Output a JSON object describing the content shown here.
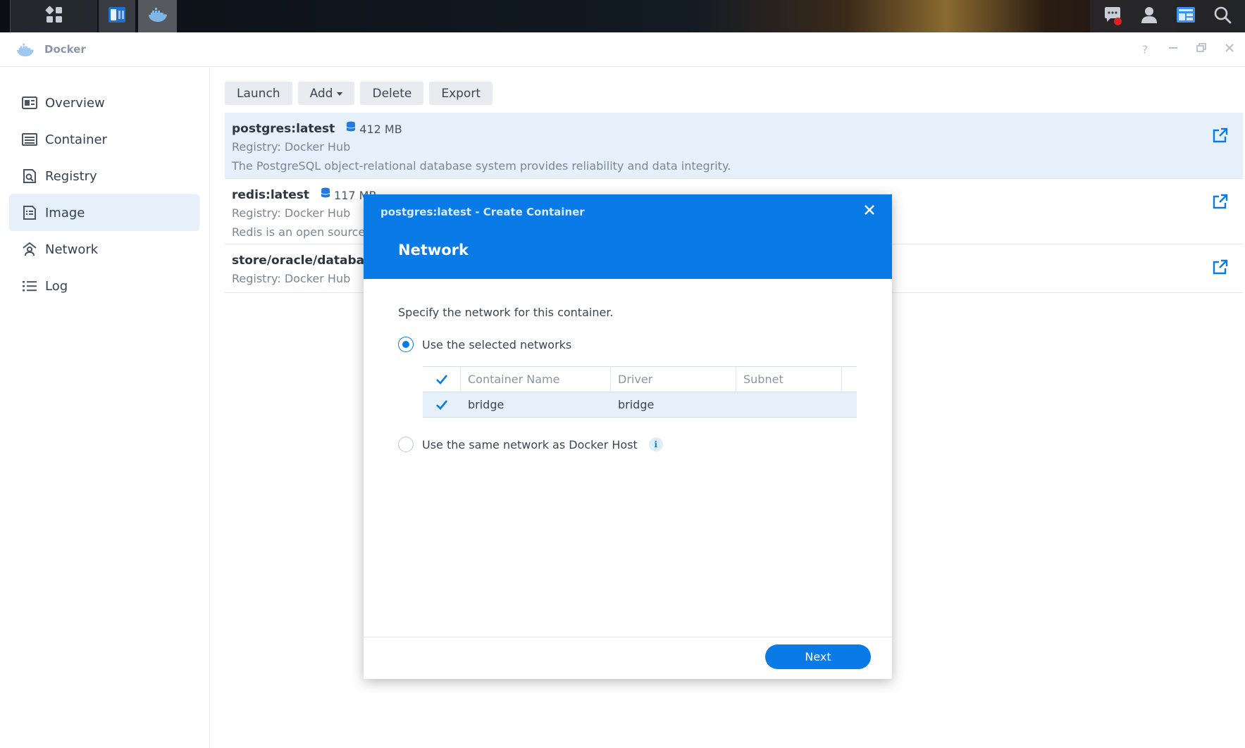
{
  "window": {
    "title": "Docker"
  },
  "sidebar": {
    "items": [
      {
        "label": "Overview",
        "icon": "overview-icon"
      },
      {
        "label": "Container",
        "icon": "container-icon"
      },
      {
        "label": "Registry",
        "icon": "registry-icon"
      },
      {
        "label": "Image",
        "icon": "image-icon",
        "active": true
      },
      {
        "label": "Network",
        "icon": "network-icon"
      },
      {
        "label": "Log",
        "icon": "log-icon"
      }
    ]
  },
  "toolbar": {
    "launch": "Launch",
    "add": "Add",
    "delete": "Delete",
    "export": "Export"
  },
  "images": [
    {
      "name": "postgres:latest",
      "size": "412 MB",
      "registry": "Registry: Docker Hub",
      "description": "The PostgreSQL object-relational database system provides reliability and data integrity."
    },
    {
      "name": "redis:latest",
      "size": "117 MB",
      "registry": "Registry: Docker Hub",
      "description": "Redis is an open source"
    },
    {
      "name": "store/oracle/databa",
      "registry": "Registry: Docker Hub"
    }
  ],
  "dialog": {
    "title": "postgres:latest - Create Container",
    "step": "Network",
    "instruction": "Specify the network for this container.",
    "option_selected": "Use the selected networks",
    "option_host": "Use the same network as Docker Host",
    "table": {
      "headers": {
        "name": "Container Name",
        "driver": "Driver",
        "subnet": "Subnet"
      },
      "rows": [
        {
          "name": "bridge",
          "driver": "bridge",
          "subnet": ""
        }
      ]
    },
    "next": "Next"
  },
  "colors": {
    "accent": "#0a7ae6",
    "selected_row": "#e6f0fb",
    "notification": "#e02020"
  }
}
